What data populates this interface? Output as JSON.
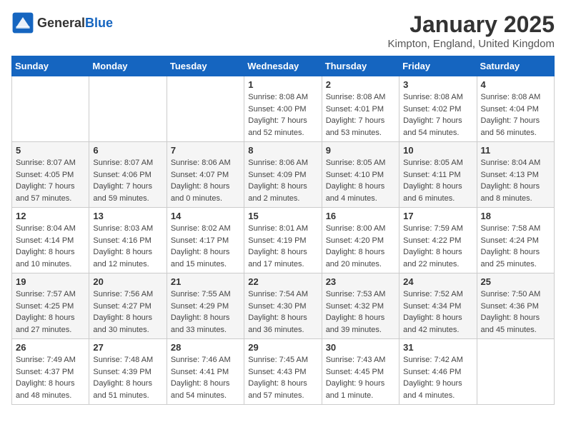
{
  "header": {
    "logo_general": "General",
    "logo_blue": "Blue",
    "month": "January 2025",
    "location": "Kimpton, England, United Kingdom"
  },
  "weekdays": [
    "Sunday",
    "Monday",
    "Tuesday",
    "Wednesday",
    "Thursday",
    "Friday",
    "Saturday"
  ],
  "weeks": [
    [
      {
        "day": "",
        "info": ""
      },
      {
        "day": "",
        "info": ""
      },
      {
        "day": "",
        "info": ""
      },
      {
        "day": "1",
        "info": "Sunrise: 8:08 AM\nSunset: 4:00 PM\nDaylight: 7 hours and 52 minutes."
      },
      {
        "day": "2",
        "info": "Sunrise: 8:08 AM\nSunset: 4:01 PM\nDaylight: 7 hours and 53 minutes."
      },
      {
        "day": "3",
        "info": "Sunrise: 8:08 AM\nSunset: 4:02 PM\nDaylight: 7 hours and 54 minutes."
      },
      {
        "day": "4",
        "info": "Sunrise: 8:08 AM\nSunset: 4:04 PM\nDaylight: 7 hours and 56 minutes."
      }
    ],
    [
      {
        "day": "5",
        "info": "Sunrise: 8:07 AM\nSunset: 4:05 PM\nDaylight: 7 hours and 57 minutes."
      },
      {
        "day": "6",
        "info": "Sunrise: 8:07 AM\nSunset: 4:06 PM\nDaylight: 7 hours and 59 minutes."
      },
      {
        "day": "7",
        "info": "Sunrise: 8:06 AM\nSunset: 4:07 PM\nDaylight: 8 hours and 0 minutes."
      },
      {
        "day": "8",
        "info": "Sunrise: 8:06 AM\nSunset: 4:09 PM\nDaylight: 8 hours and 2 minutes."
      },
      {
        "day": "9",
        "info": "Sunrise: 8:05 AM\nSunset: 4:10 PM\nDaylight: 8 hours and 4 minutes."
      },
      {
        "day": "10",
        "info": "Sunrise: 8:05 AM\nSunset: 4:11 PM\nDaylight: 8 hours and 6 minutes."
      },
      {
        "day": "11",
        "info": "Sunrise: 8:04 AM\nSunset: 4:13 PM\nDaylight: 8 hours and 8 minutes."
      }
    ],
    [
      {
        "day": "12",
        "info": "Sunrise: 8:04 AM\nSunset: 4:14 PM\nDaylight: 8 hours and 10 minutes."
      },
      {
        "day": "13",
        "info": "Sunrise: 8:03 AM\nSunset: 4:16 PM\nDaylight: 8 hours and 12 minutes."
      },
      {
        "day": "14",
        "info": "Sunrise: 8:02 AM\nSunset: 4:17 PM\nDaylight: 8 hours and 15 minutes."
      },
      {
        "day": "15",
        "info": "Sunrise: 8:01 AM\nSunset: 4:19 PM\nDaylight: 8 hours and 17 minutes."
      },
      {
        "day": "16",
        "info": "Sunrise: 8:00 AM\nSunset: 4:20 PM\nDaylight: 8 hours and 20 minutes."
      },
      {
        "day": "17",
        "info": "Sunrise: 7:59 AM\nSunset: 4:22 PM\nDaylight: 8 hours and 22 minutes."
      },
      {
        "day": "18",
        "info": "Sunrise: 7:58 AM\nSunset: 4:24 PM\nDaylight: 8 hours and 25 minutes."
      }
    ],
    [
      {
        "day": "19",
        "info": "Sunrise: 7:57 AM\nSunset: 4:25 PM\nDaylight: 8 hours and 27 minutes."
      },
      {
        "day": "20",
        "info": "Sunrise: 7:56 AM\nSunset: 4:27 PM\nDaylight: 8 hours and 30 minutes."
      },
      {
        "day": "21",
        "info": "Sunrise: 7:55 AM\nSunset: 4:29 PM\nDaylight: 8 hours and 33 minutes."
      },
      {
        "day": "22",
        "info": "Sunrise: 7:54 AM\nSunset: 4:30 PM\nDaylight: 8 hours and 36 minutes."
      },
      {
        "day": "23",
        "info": "Sunrise: 7:53 AM\nSunset: 4:32 PM\nDaylight: 8 hours and 39 minutes."
      },
      {
        "day": "24",
        "info": "Sunrise: 7:52 AM\nSunset: 4:34 PM\nDaylight: 8 hours and 42 minutes."
      },
      {
        "day": "25",
        "info": "Sunrise: 7:50 AM\nSunset: 4:36 PM\nDaylight: 8 hours and 45 minutes."
      }
    ],
    [
      {
        "day": "26",
        "info": "Sunrise: 7:49 AM\nSunset: 4:37 PM\nDaylight: 8 hours and 48 minutes."
      },
      {
        "day": "27",
        "info": "Sunrise: 7:48 AM\nSunset: 4:39 PM\nDaylight: 8 hours and 51 minutes."
      },
      {
        "day": "28",
        "info": "Sunrise: 7:46 AM\nSunset: 4:41 PM\nDaylight: 8 hours and 54 minutes."
      },
      {
        "day": "29",
        "info": "Sunrise: 7:45 AM\nSunset: 4:43 PM\nDaylight: 8 hours and 57 minutes."
      },
      {
        "day": "30",
        "info": "Sunrise: 7:43 AM\nSunset: 4:45 PM\nDaylight: 9 hours and 1 minute."
      },
      {
        "day": "31",
        "info": "Sunrise: 7:42 AM\nSunset: 4:46 PM\nDaylight: 9 hours and 4 minutes."
      },
      {
        "day": "",
        "info": ""
      }
    ]
  ]
}
